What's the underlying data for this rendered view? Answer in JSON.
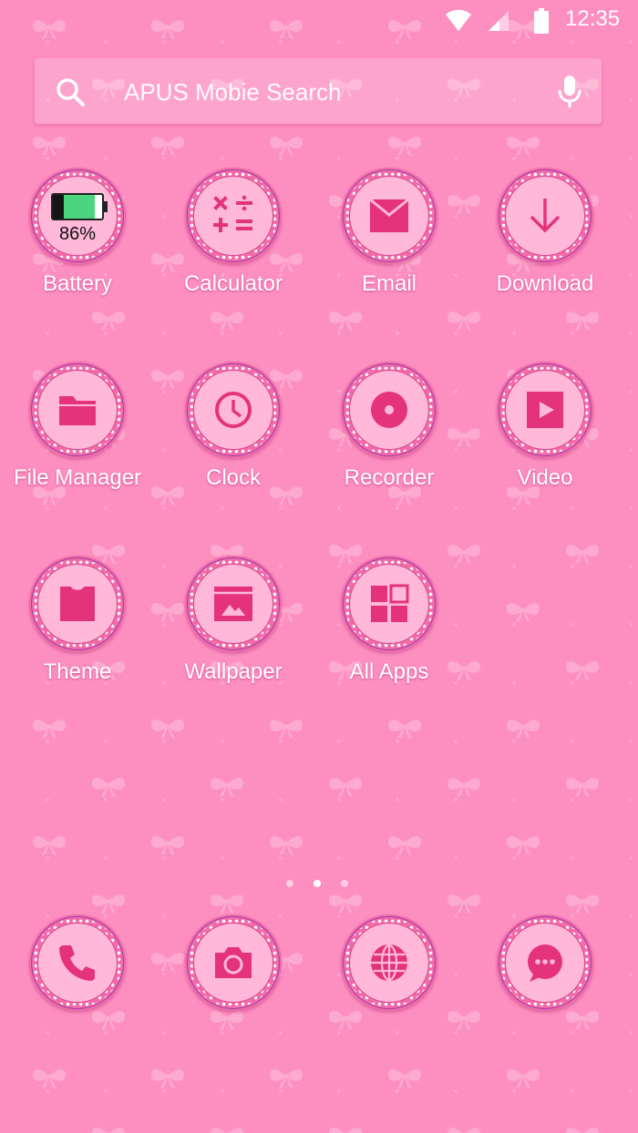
{
  "status_bar": {
    "time": "12:35"
  },
  "search": {
    "placeholder": "APUS Mobie Search"
  },
  "apps": {
    "battery": {
      "label": "Battery",
      "percent_text": "86%",
      "level": 0.86
    },
    "calculator": {
      "label": "Calculator"
    },
    "email": {
      "label": "Email"
    },
    "download": {
      "label": "Download"
    },
    "file_manager": {
      "label": "File Manager"
    },
    "clock": {
      "label": "Clock"
    },
    "recorder": {
      "label": "Recorder"
    },
    "video": {
      "label": "Video"
    },
    "theme": {
      "label": "Theme"
    },
    "wallpaper": {
      "label": "Wallpaper"
    },
    "all_apps": {
      "label": "All Apps"
    }
  },
  "dock": [
    {
      "icon": "phone-icon"
    },
    {
      "icon": "camera-icon"
    },
    {
      "icon": "globe-icon"
    },
    {
      "icon": "messages-icon"
    }
  ],
  "pager": {
    "pages": 3,
    "current": 2
  },
  "colors": {
    "background": "#fd8ec0",
    "icon_glyph": "#e4337a",
    "icon_face": "#ffb8d7",
    "ring": "#f26aa8"
  }
}
